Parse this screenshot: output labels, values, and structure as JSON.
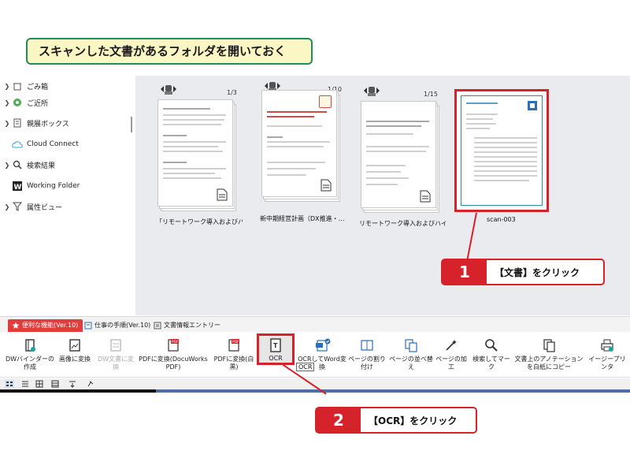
{
  "banner": {
    "text": "スキャンした文書があるフォルダを開いておく"
  },
  "sidebar": {
    "items": [
      {
        "label": "ごみ箱",
        "icon": "trash-icon"
      },
      {
        "label": "ご近所",
        "icon": "neighborhood-icon"
      },
      {
        "label": "親展ボックス",
        "icon": "confidential-box-icon"
      },
      {
        "label": "Cloud Connect",
        "icon": "cloud-icon"
      },
      {
        "label": "検索結果",
        "icon": "search-icon"
      },
      {
        "label": "Working Folder",
        "icon": "working-folder-icon"
      },
      {
        "label": "属性ビュー",
        "icon": "filter-icon"
      }
    ]
  },
  "documents": [
    {
      "name": "「リモートワーク導入およびハイ…",
      "pages": "1/3"
    },
    {
      "name": "新中期経営計画（DX推進・…",
      "pages": "1/10"
    },
    {
      "name": "リモートワーク導入およびハイブ…",
      "pages": "1/15"
    },
    {
      "name": "scan-003",
      "pages": ""
    }
  ],
  "callouts": {
    "step1": {
      "number": "1",
      "text": "【文書】をクリック"
    },
    "step2": {
      "number": "2",
      "text": "【OCR】をクリック"
    }
  },
  "ribbon": {
    "tabs": [
      {
        "label": "便利な機能(Ver.10)",
        "active": true
      },
      {
        "label": "仕事の手順(Ver.10)",
        "active": false
      },
      {
        "label": "文書情報エントリー",
        "active": false
      }
    ],
    "buttons": [
      {
        "label": "DWバインダーの作成",
        "icon": "binder-icon",
        "disabled": false
      },
      {
        "label": "画像に変換",
        "icon": "image-convert-icon",
        "disabled": false
      },
      {
        "label": "DW文書に変換",
        "icon": "dw-convert-icon",
        "disabled": true
      },
      {
        "label": "PDFに変換(DocuWorks PDF)",
        "icon": "pdf-icon",
        "disabled": false
      },
      {
        "label": "PDFに変換(白黒)",
        "icon": "pdf-bw-icon",
        "disabled": false
      },
      {
        "label": "OCR",
        "icon": "ocr-icon",
        "disabled": false
      },
      {
        "label": "OCRしてWord変換",
        "icon": "ocr-word-icon",
        "disabled": false
      },
      {
        "label": "ページの割り付け",
        "icon": "page-layout-icon",
        "disabled": false
      },
      {
        "label": "ページの並べ替え",
        "icon": "page-sort-icon",
        "disabled": false
      },
      {
        "label": "ページの加工",
        "icon": "page-edit-icon",
        "disabled": false
      },
      {
        "label": "検索してマーク",
        "icon": "search-mark-icon",
        "disabled": false
      },
      {
        "label": "文書上のアノテーションを白紙にコピー",
        "icon": "annotation-copy-icon",
        "disabled": false
      },
      {
        "label": "イージープリンタ",
        "icon": "printer-icon",
        "disabled": false
      }
    ],
    "tooltip": "OCR"
  },
  "colors": {
    "accent_red": "#d6222a",
    "banner_border": "#1f8f5a",
    "banner_bg": "#fbf7c4"
  }
}
